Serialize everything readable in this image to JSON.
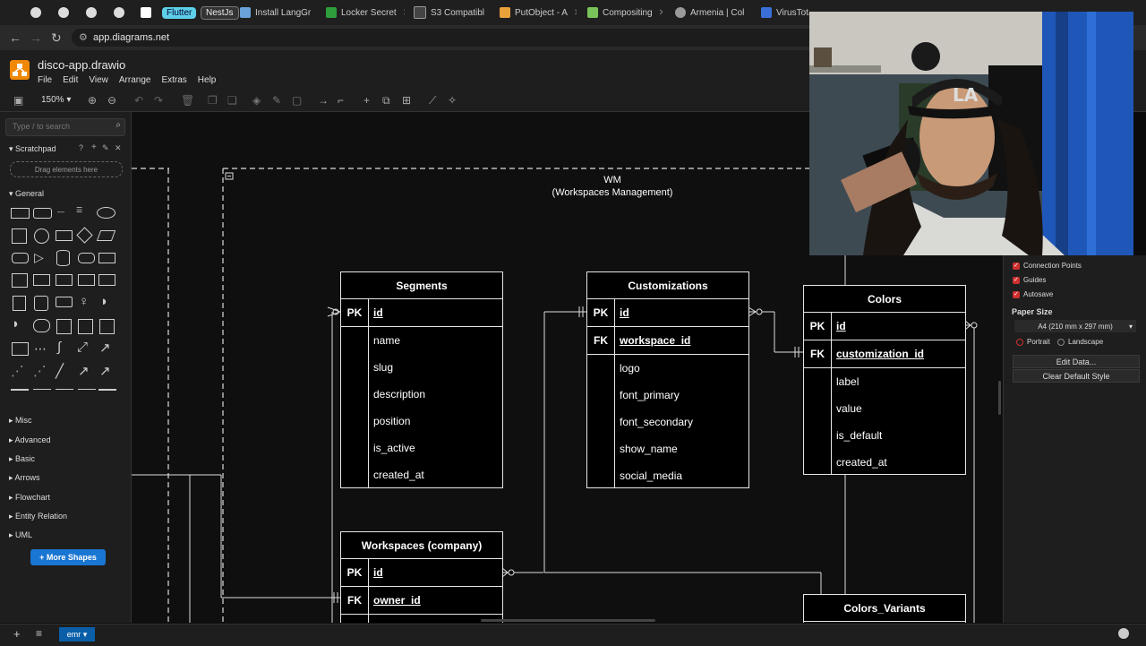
{
  "browser": {
    "tabs": [
      {
        "label": "",
        "icon": "github-icon"
      },
      {
        "label": "",
        "icon": "github-icon"
      },
      {
        "label": "",
        "icon": "github-icon"
      },
      {
        "label": "",
        "icon": "github-icon"
      },
      {
        "label": "",
        "icon": "gmail-icon"
      },
      {
        "label": "Flutter",
        "icon": "flutter-pill"
      },
      {
        "label": "NestJs",
        "icon": "nestjs-pill"
      },
      {
        "label": "Install LangGr",
        "icon": "docs-icon"
      },
      {
        "label": "Locker Secret",
        "icon": "shield-icon"
      },
      {
        "label": "S3 Compatibl",
        "icon": "docs-icon"
      },
      {
        "label": "PutObject - A",
        "icon": "docs-icon"
      },
      {
        "label": "Compositing",
        "icon": "puzzle-icon"
      },
      {
        "label": "Armenia | Col",
        "icon": "globe-icon"
      },
      {
        "label": "VirusTotal - U",
        "icon": "virustotal-icon"
      }
    ],
    "url": "app.diagrams.net"
  },
  "app": {
    "title": "disco-app.drawio",
    "menu": [
      "File",
      "Edit",
      "View",
      "Arrange",
      "Extras",
      "Help"
    ],
    "zoom": "150%"
  },
  "sidebar": {
    "search_placeholder": "Type / to search",
    "scratchpad": "Scratchpad",
    "drag_hint": "Drag elements here",
    "general": "General",
    "categories": [
      "Misc",
      "Advanced",
      "Basic",
      "Arrows",
      "Flowchart",
      "Entity Relation",
      "UML"
    ],
    "more_shapes": "+ More Shapes"
  },
  "canvas": {
    "container_title_1": "WM",
    "container_title_2": "(Workspaces Management)",
    "tables": {
      "segments": {
        "name": "Segments",
        "rows": [
          {
            "key": "PK",
            "field": "id"
          },
          {
            "key": "",
            "field": "name"
          },
          {
            "key": "",
            "field": "slug"
          },
          {
            "key": "",
            "field": "description"
          },
          {
            "key": "",
            "field": "position"
          },
          {
            "key": "",
            "field": "is_active"
          },
          {
            "key": "",
            "field": "created_at"
          }
        ]
      },
      "customizations": {
        "name": "Customizations",
        "rows": [
          {
            "key": "PK",
            "field": "id"
          },
          {
            "key": "FK",
            "field": "workspace_id"
          },
          {
            "key": "",
            "field": "logo"
          },
          {
            "key": "",
            "field": "font_primary"
          },
          {
            "key": "",
            "field": "font_secondary"
          },
          {
            "key": "",
            "field": "show_name"
          },
          {
            "key": "",
            "field": "social_media"
          }
        ]
      },
      "colors": {
        "name": "Colors",
        "rows": [
          {
            "key": "PK",
            "field": "id"
          },
          {
            "key": "FK",
            "field": "customization_id"
          },
          {
            "key": "",
            "field": "label"
          },
          {
            "key": "",
            "field": "value"
          },
          {
            "key": "",
            "field": "is_default"
          },
          {
            "key": "",
            "field": "created_at"
          }
        ]
      },
      "workspaces": {
        "name": "Workspaces (company)",
        "rows": [
          {
            "key": "PK",
            "field": "id"
          },
          {
            "key": "FK",
            "field": "owner_id"
          }
        ]
      },
      "colors_variants": {
        "name": "Colors_Variants",
        "rows": []
      }
    }
  },
  "right_panel": {
    "connection_points": "Connection Points",
    "guides": "Guides",
    "autosave": "Autosave",
    "paper_size": "Paper Size",
    "paper_value": "A4 (210 mm x 297 mm)",
    "portrait": "Portrait",
    "landscape": "Landscape",
    "edit_data": "Edit Data...",
    "clear_style": "Clear Default Style"
  },
  "footer": {
    "page_tab": "emr"
  }
}
